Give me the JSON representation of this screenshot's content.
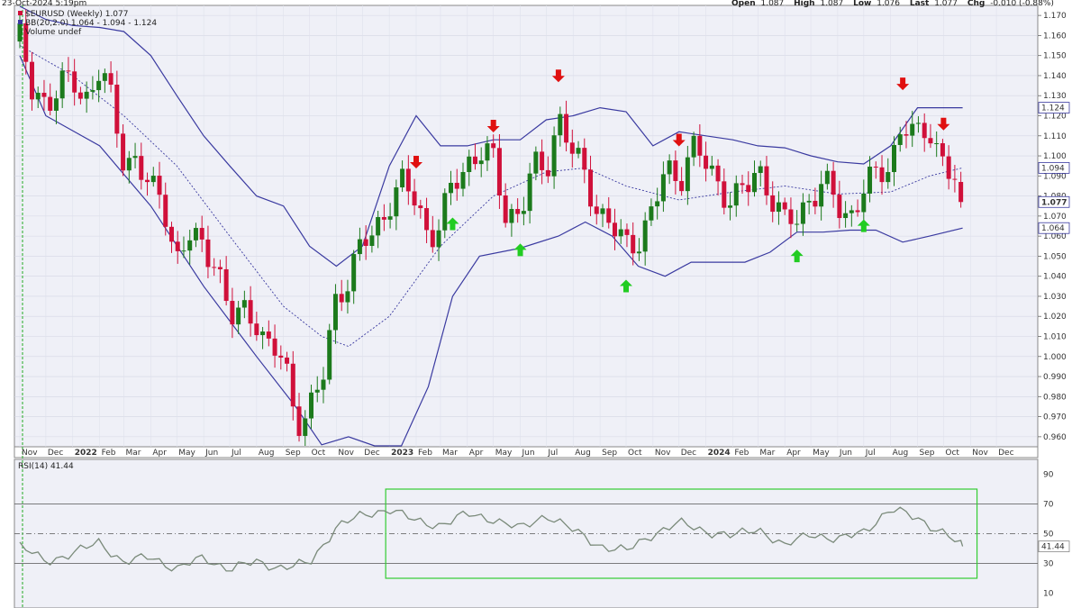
{
  "header": {
    "timestamp": "23-Oct-2024 5:19pm",
    "quote": {
      "open_label": "Open",
      "open": "1.087",
      "high_label": "High",
      "high": "1.087",
      "low_label": "Low",
      "low": "1.076",
      "last_label": "Last",
      "last": "1.077",
      "chg_label": "Chg",
      "chg": "-0.010 (-0.88%)"
    }
  },
  "legend": {
    "symbol_line": "$EURUSD (Weekly) 1.077",
    "bb_line": "BB(20,2.0) 1.064 - 1.094 - 1.124",
    "volume_line": "Volume undef"
  },
  "rsi_legend": "RSI(14) 41.44",
  "colors": {
    "background": "#eff0f7",
    "up_candle": "#1c7a1c",
    "down_candle": "#d0103a",
    "bollinger": "#3a3aa0",
    "rsi_line": "#7a8a7a",
    "rsi_highlight_box": "#33cc33",
    "arrow_down": "#e01010",
    "arrow_up": "#22cc22"
  },
  "chart_data": [
    {
      "type": "candlestick",
      "title": "$EURUSD (Weekly) 1.077",
      "indicator": "BB(20,2.0) 1.064 - 1.094 - 1.124",
      "ylim": [
        0.955,
        1.175
      ],
      "y_ticks": [
        "1.170",
        "1.160",
        "1.150",
        "1.140",
        "1.130",
        "1.120",
        "1.110",
        "1.100",
        "1.090",
        "1.080",
        "1.070",
        "1.060",
        "1.050",
        "1.040",
        "1.030",
        "1.020",
        "1.010",
        "1.000",
        "0.990",
        "0.980",
        "0.970",
        "0.960"
      ],
      "price_badges": {
        "upper": "1.124",
        "middle": "1.094",
        "last": "1.077",
        "lower": "1.064"
      },
      "x_labels": [
        "Nov",
        "Dec",
        "2022",
        "Feb",
        "Mar",
        "Apr",
        "May",
        "Jun",
        "Jul",
        "Aug",
        "Sep",
        "Oct",
        "Nov",
        "Dec",
        "2023",
        "Feb",
        "Mar",
        "Apr",
        "May",
        "Jun",
        "Jul",
        "Aug",
        "Sep",
        "Oct",
        "Nov",
        "Dec",
        "2024",
        "Feb",
        "Mar",
        "Apr",
        "May",
        "Jun",
        "Jul",
        "Aug",
        "Sep",
        "Oct",
        "Nov",
        "Dec"
      ],
      "close_path": [
        [
          "2021-11-01",
          1.157
        ],
        [
          "2021-11-15",
          1.132
        ],
        [
          "2021-12-01",
          1.128
        ],
        [
          "2021-12-15",
          1.133
        ],
        [
          "2022-01-01",
          1.137
        ],
        [
          "2022-01-15",
          1.128
        ],
        [
          "2022-02-01",
          1.144
        ],
        [
          "2022-02-15",
          1.125
        ],
        [
          "2022-03-01",
          1.097
        ],
        [
          "2022-03-15",
          1.1
        ],
        [
          "2022-04-01",
          1.081
        ],
        [
          "2022-04-15",
          1.078
        ],
        [
          "2022-05-01",
          1.049
        ],
        [
          "2022-05-15",
          1.06
        ],
        [
          "2022-06-01",
          1.052
        ],
        [
          "2022-06-15",
          1.051
        ],
        [
          "2022-07-01",
          1.018
        ],
        [
          "2022-07-15",
          1.021
        ],
        [
          "2022-08-01",
          1.02
        ],
        [
          "2022-08-15",
          1.004
        ],
        [
          "2022-09-01",
          0.998
        ],
        [
          "2022-09-15",
          0.969
        ],
        [
          "2022-10-01",
          0.974
        ],
        [
          "2022-10-15",
          0.985
        ],
        [
          "2022-11-01",
          1.031
        ],
        [
          "2022-11-15",
          1.04
        ],
        [
          "2022-12-01",
          1.055
        ],
        [
          "2022-12-15",
          1.062
        ],
        [
          "2023-01-01",
          1.078
        ],
        [
          "2023-01-15",
          1.085
        ],
        [
          "2023-02-01",
          1.078
        ],
        [
          "2023-02-15",
          1.061
        ],
        [
          "2023-03-01",
          1.065
        ],
        [
          "2023-03-15",
          1.085
        ],
        [
          "2023-04-01",
          1.097
        ],
        [
          "2023-04-15",
          1.103
        ],
        [
          "2023-05-01",
          1.096
        ],
        [
          "2023-05-15",
          1.072
        ],
        [
          "2023-06-01",
          1.072
        ],
        [
          "2023-06-15",
          1.092
        ],
        [
          "2023-07-01",
          1.094
        ],
        [
          "2023-07-15",
          1.121
        ],
        [
          "2023-08-01",
          1.1
        ],
        [
          "2023-08-15",
          1.089
        ],
        [
          "2023-09-01",
          1.072
        ],
        [
          "2023-09-15",
          1.064
        ],
        [
          "2023-10-01",
          1.054
        ],
        [
          "2023-10-15",
          1.06
        ],
        [
          "2023-11-01",
          1.072
        ],
        [
          "2023-11-15",
          1.092
        ],
        [
          "2023-12-01",
          1.089
        ],
        [
          "2023-12-15",
          1.105
        ],
        [
          "2024-01-01",
          1.095
        ],
        [
          "2024-01-15",
          1.086
        ],
        [
          "2024-02-01",
          1.079
        ],
        [
          "2024-02-15",
          1.081
        ],
        [
          "2024-03-01",
          1.094
        ],
        [
          "2024-03-15",
          1.083
        ],
        [
          "2024-04-01",
          1.065
        ],
        [
          "2024-04-15",
          1.069
        ],
        [
          "2024-05-01",
          1.081
        ],
        [
          "2024-05-15",
          1.086
        ],
        [
          "2024-06-01",
          1.075
        ],
        [
          "2024-06-15",
          1.07
        ],
        [
          "2024-07-01",
          1.084
        ],
        [
          "2024-07-15",
          1.088
        ],
        [
          "2024-08-01",
          1.098
        ],
        [
          "2024-08-15",
          1.117
        ],
        [
          "2024-09-01",
          1.107
        ],
        [
          "2024-09-15",
          1.115
        ],
        [
          "2024-10-01",
          1.097
        ],
        [
          "2024-10-15",
          1.086
        ],
        [
          "2024-10-23",
          1.077
        ]
      ],
      "bb_upper": [
        [
          "2021-11-01",
          1.18
        ],
        [
          "2021-12-01",
          1.168
        ],
        [
          "2022-01-01",
          1.165
        ],
        [
          "2022-02-01",
          1.164
        ],
        [
          "2022-03-01",
          1.162
        ],
        [
          "2022-04-01",
          1.15
        ],
        [
          "2022-05-01",
          1.13
        ],
        [
          "2022-06-01",
          1.11
        ],
        [
          "2022-07-01",
          1.095
        ],
        [
          "2022-08-01",
          1.08
        ],
        [
          "2022-09-01",
          1.075
        ],
        [
          "2022-10-01",
          1.055
        ],
        [
          "2022-11-01",
          1.045
        ],
        [
          "2022-12-01",
          1.055
        ],
        [
          "2023-01-01",
          1.095
        ],
        [
          "2023-02-01",
          1.12
        ],
        [
          "2023-03-01",
          1.105
        ],
        [
          "2023-04-01",
          1.105
        ],
        [
          "2023-05-01",
          1.108
        ],
        [
          "2023-06-01",
          1.108
        ],
        [
          "2023-07-01",
          1.118
        ],
        [
          "2023-08-01",
          1.12
        ],
        [
          "2023-09-01",
          1.124
        ],
        [
          "2023-10-01",
          1.122
        ],
        [
          "2023-11-01",
          1.105
        ],
        [
          "2023-12-01",
          1.112
        ],
        [
          "2024-01-01",
          1.11
        ],
        [
          "2024-02-01",
          1.108
        ],
        [
          "2024-03-01",
          1.105
        ],
        [
          "2024-04-01",
          1.104
        ],
        [
          "2024-05-01",
          1.1
        ],
        [
          "2024-06-01",
          1.097
        ],
        [
          "2024-07-01",
          1.096
        ],
        [
          "2024-08-01",
          1.105
        ],
        [
          "2024-09-01",
          1.124
        ],
        [
          "2024-10-23",
          1.124
        ]
      ],
      "bb_middle": [
        [
          "2021-11-01",
          1.155
        ],
        [
          "2022-01-01",
          1.14
        ],
        [
          "2022-03-01",
          1.12
        ],
        [
          "2022-05-01",
          1.095
        ],
        [
          "2022-07-01",
          1.06
        ],
        [
          "2022-09-01",
          1.025
        ],
        [
          "2022-10-15",
          1.01
        ],
        [
          "2022-11-15",
          1.005
        ],
        [
          "2023-01-01",
          1.02
        ],
        [
          "2023-03-01",
          1.055
        ],
        [
          "2023-05-01",
          1.08
        ],
        [
          "2023-07-01",
          1.092
        ],
        [
          "2023-08-15",
          1.094
        ],
        [
          "2023-10-01",
          1.085
        ],
        [
          "2023-12-01",
          1.078
        ],
        [
          "2024-02-01",
          1.082
        ],
        [
          "2024-04-01",
          1.085
        ],
        [
          "2024-06-01",
          1.081
        ],
        [
          "2024-08-01",
          1.082
        ],
        [
          "2024-09-15",
          1.09
        ],
        [
          "2024-10-23",
          1.094
        ]
      ],
      "bb_lower": [
        [
          "2021-11-01",
          1.15
        ],
        [
          "2021-12-01",
          1.12
        ],
        [
          "2022-02-01",
          1.105
        ],
        [
          "2022-04-01",
          1.075
        ],
        [
          "2022-06-01",
          1.035
        ],
        [
          "2022-08-01",
          1.0
        ],
        [
          "2022-09-15",
          0.975
        ],
        [
          "2022-10-15",
          0.956
        ],
        [
          "2022-11-15",
          0.96
        ],
        [
          "2022-12-15",
          0.95
        ],
        [
          "2023-01-15",
          0.94
        ],
        [
          "2023-02-15",
          0.985
        ],
        [
          "2023-03-15",
          1.03
        ],
        [
          "2023-04-15",
          1.05
        ],
        [
          "2023-06-01",
          1.054
        ],
        [
          "2023-07-15",
          1.06
        ],
        [
          "2023-08-15",
          1.067
        ],
        [
          "2023-09-15",
          1.06
        ],
        [
          "2023-10-15",
          1.045
        ],
        [
          "2023-11-15",
          1.04
        ],
        [
          "2023-12-15",
          1.047
        ],
        [
          "2024-01-15",
          1.047
        ],
        [
          "2024-02-15",
          1.047
        ],
        [
          "2024-03-15",
          1.052
        ],
        [
          "2024-04-15",
          1.062
        ],
        [
          "2024-05-15",
          1.062
        ],
        [
          "2024-06-15",
          1.063
        ],
        [
          "2024-07-15",
          1.063
        ],
        [
          "2024-08-15",
          1.057
        ],
        [
          "2024-09-15",
          1.06
        ],
        [
          "2024-10-23",
          1.064
        ]
      ],
      "signal_arrows": {
        "down": [
          "2023-02-01",
          "2023-05-01",
          "2023-07-15",
          "2023-12-01",
          "2024-08-15",
          "2024-10-01"
        ],
        "up": [
          "2023-03-15",
          "2023-06-01",
          "2023-10-01",
          "2024-04-15",
          "2024-07-01"
        ]
      }
    },
    {
      "type": "line",
      "title": "RSI(14) 41.44",
      "ylim": [
        0,
        100
      ],
      "y_ticks": [
        "90",
        "70",
        "50",
        "41.44",
        "30",
        "10"
      ],
      "reference_lines": [
        70,
        50,
        30
      ],
      "highlight_range": {
        "x_start": "2023-01-01",
        "x_end": "2024-10-23",
        "y_low": 20,
        "y_high": 80
      },
      "series": [
        {
          "values": [
            [
              "2021-11-01",
              41
            ],
            [
              "2021-12-01",
              32
            ],
            [
              "2022-01-01",
              36
            ],
            [
              "2022-02-01",
              45
            ],
            [
              "2022-03-01",
              30
            ],
            [
              "2022-04-01",
              35
            ],
            [
              "2022-05-01",
              26
            ],
            [
              "2022-06-01",
              34
            ],
            [
              "2022-07-01",
              26
            ],
            [
              "2022-08-01",
              31
            ],
            [
              "2022-09-01",
              27
            ],
            [
              "2022-10-01",
              30
            ],
            [
              "2022-11-01",
              55
            ],
            [
              "2022-12-01",
              62
            ],
            [
              "2023-01-01",
              67
            ],
            [
              "2023-02-01",
              58
            ],
            [
              "2023-03-01",
              56
            ],
            [
              "2023-04-01",
              63
            ],
            [
              "2023-05-01",
              60
            ],
            [
              "2023-06-01",
              53
            ],
            [
              "2023-07-01",
              63
            ],
            [
              "2023-08-01",
              52
            ],
            [
              "2023-09-01",
              42
            ],
            [
              "2023-10-01",
              38
            ],
            [
              "2023-11-01",
              50
            ],
            [
              "2023-12-01",
              57
            ],
            [
              "2024-01-01",
              52
            ],
            [
              "2024-02-01",
              48
            ],
            [
              "2024-03-01",
              54
            ],
            [
              "2024-04-01",
              41
            ],
            [
              "2024-05-01",
              51
            ],
            [
              "2024-06-01",
              45
            ],
            [
              "2024-07-01",
              52
            ],
            [
              "2024-08-01",
              66
            ],
            [
              "2024-09-01",
              61
            ],
            [
              "2024-10-01",
              50
            ],
            [
              "2024-10-23",
              41.44
            ]
          ]
        }
      ]
    }
  ]
}
